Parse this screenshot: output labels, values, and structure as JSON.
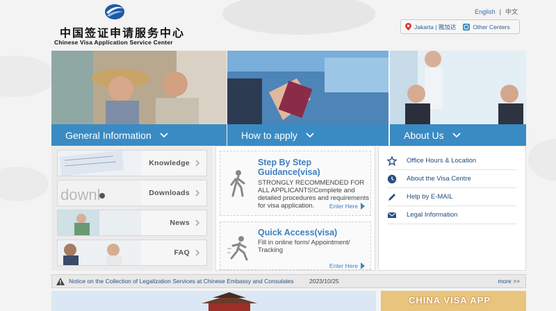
{
  "header": {
    "logo_cn": "中国签证申请服务中心",
    "logo_en": "Chinese Visa Application Service Center",
    "lang_en": "English",
    "lang_sep": "|",
    "lang_cn": "中文",
    "location_city": "Jakarta | 雅加达",
    "other_centers": "Other Centers"
  },
  "banners": [
    {
      "label": "General Information"
    },
    {
      "label": "How to apply"
    },
    {
      "label": "About Us"
    }
  ],
  "general_info": [
    {
      "label": "Knowledge"
    },
    {
      "label": "Downloads"
    },
    {
      "label": "News"
    },
    {
      "label": "FAQ"
    }
  ],
  "how_to_apply": {
    "step_title": "Step By Step Guidance(visa)",
    "step_text": "STRONGLY RECOMMENDED FOR ALL APPLICANTS!Complete and detailed procedures and requirements for visa application.",
    "step_overlay": "Enter Here",
    "quick_title": "Quick Access(visa)",
    "quick_text": "Fill in online form/ Appointment/ Tracking",
    "quick_link": "Enter Here"
  },
  "about_us": [
    {
      "label": "Office Hours & Location"
    },
    {
      "label": "About the Visa Centre"
    },
    {
      "label": "Help by E-MAIL"
    },
    {
      "label": "Legal Information"
    }
  ],
  "ticker": {
    "news": "Notice on the Collection of Legalization Services at Chinese Embassy and Consulates",
    "date": "2023/10/25",
    "more": "more >>"
  },
  "bottom": {
    "app_text": "CHINA VISA  APP"
  },
  "colors": {
    "accent_blue": "#3a8bc4",
    "link_blue": "#3d7fc0"
  }
}
